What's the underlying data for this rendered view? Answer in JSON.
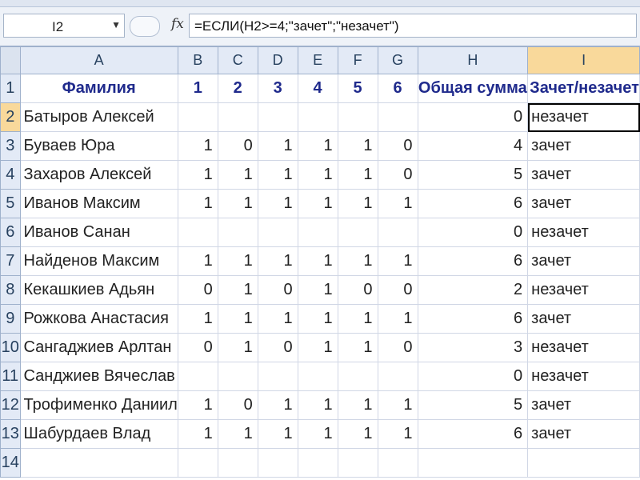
{
  "formula_bar": {
    "name_box": "I2",
    "formula": "=ЕСЛИ(H2>=4;\"зачет\";\"незачет\")",
    "fx_label": "fx"
  },
  "columns": [
    "A",
    "B",
    "C",
    "D",
    "E",
    "F",
    "G",
    "H",
    "I"
  ],
  "headers": {
    "name": "Фамилия",
    "tasks": [
      "1",
      "2",
      "3",
      "4",
      "5",
      "6"
    ],
    "total": "Общая сумма",
    "result": "Зачет/незачет"
  },
  "rows": [
    {
      "num": "2",
      "name": "Батыров Алексей",
      "scores": [
        "",
        "",
        "",
        "",
        "",
        ""
      ],
      "total": "0",
      "result": "незачет"
    },
    {
      "num": "3",
      "name": "Буваев Юра",
      "scores": [
        "1",
        "0",
        "1",
        "1",
        "1",
        "0"
      ],
      "total": "4",
      "result": "зачет"
    },
    {
      "num": "4",
      "name": "Захаров Алексей",
      "scores": [
        "1",
        "1",
        "1",
        "1",
        "1",
        "0"
      ],
      "total": "5",
      "result": "зачет"
    },
    {
      "num": "5",
      "name": "Иванов Максим",
      "scores": [
        "1",
        "1",
        "1",
        "1",
        "1",
        "1"
      ],
      "total": "6",
      "result": "зачет"
    },
    {
      "num": "6",
      "name": "Иванов Санан",
      "scores": [
        "",
        "",
        "",
        "",
        "",
        ""
      ],
      "total": "0",
      "result": "незачет"
    },
    {
      "num": "7",
      "name": "Найденов Максим",
      "scores": [
        "1",
        "1",
        "1",
        "1",
        "1",
        "1"
      ],
      "total": "6",
      "result": "зачет"
    },
    {
      "num": "8",
      "name": "Кекашкиев Адьян",
      "scores": [
        "0",
        "1",
        "0",
        "1",
        "0",
        "0"
      ],
      "total": "2",
      "result": "незачет"
    },
    {
      "num": "9",
      "name": "Рожкова Анастасия",
      "scores": [
        "1",
        "1",
        "1",
        "1",
        "1",
        "1"
      ],
      "total": "6",
      "result": "зачет"
    },
    {
      "num": "10",
      "name": "Сангаджиев Арлтан",
      "scores": [
        "0",
        "1",
        "0",
        "1",
        "1",
        "0"
      ],
      "total": "3",
      "result": "незачет"
    },
    {
      "num": "11",
      "name": "Санджиев Вячеслав",
      "scores": [
        "",
        "",
        "",
        "",
        "",
        ""
      ],
      "total": "0",
      "result": "незачет"
    },
    {
      "num": "12",
      "name": "Трофименко Даниил",
      "scores": [
        "1",
        "0",
        "1",
        "1",
        "1",
        "1"
      ],
      "total": "5",
      "result": "зачет"
    },
    {
      "num": "13",
      "name": "Шабурдаев Влад",
      "scores": [
        "1",
        "1",
        "1",
        "1",
        "1",
        "1"
      ],
      "total": "6",
      "result": "зачет"
    }
  ],
  "header_row_num": "1",
  "empty_row_num": "14",
  "selected_cell": "I2",
  "colors": {
    "header_text": "#1f2a8c",
    "active_header": "#f9d99b",
    "grid_line": "#d0d7e5"
  }
}
